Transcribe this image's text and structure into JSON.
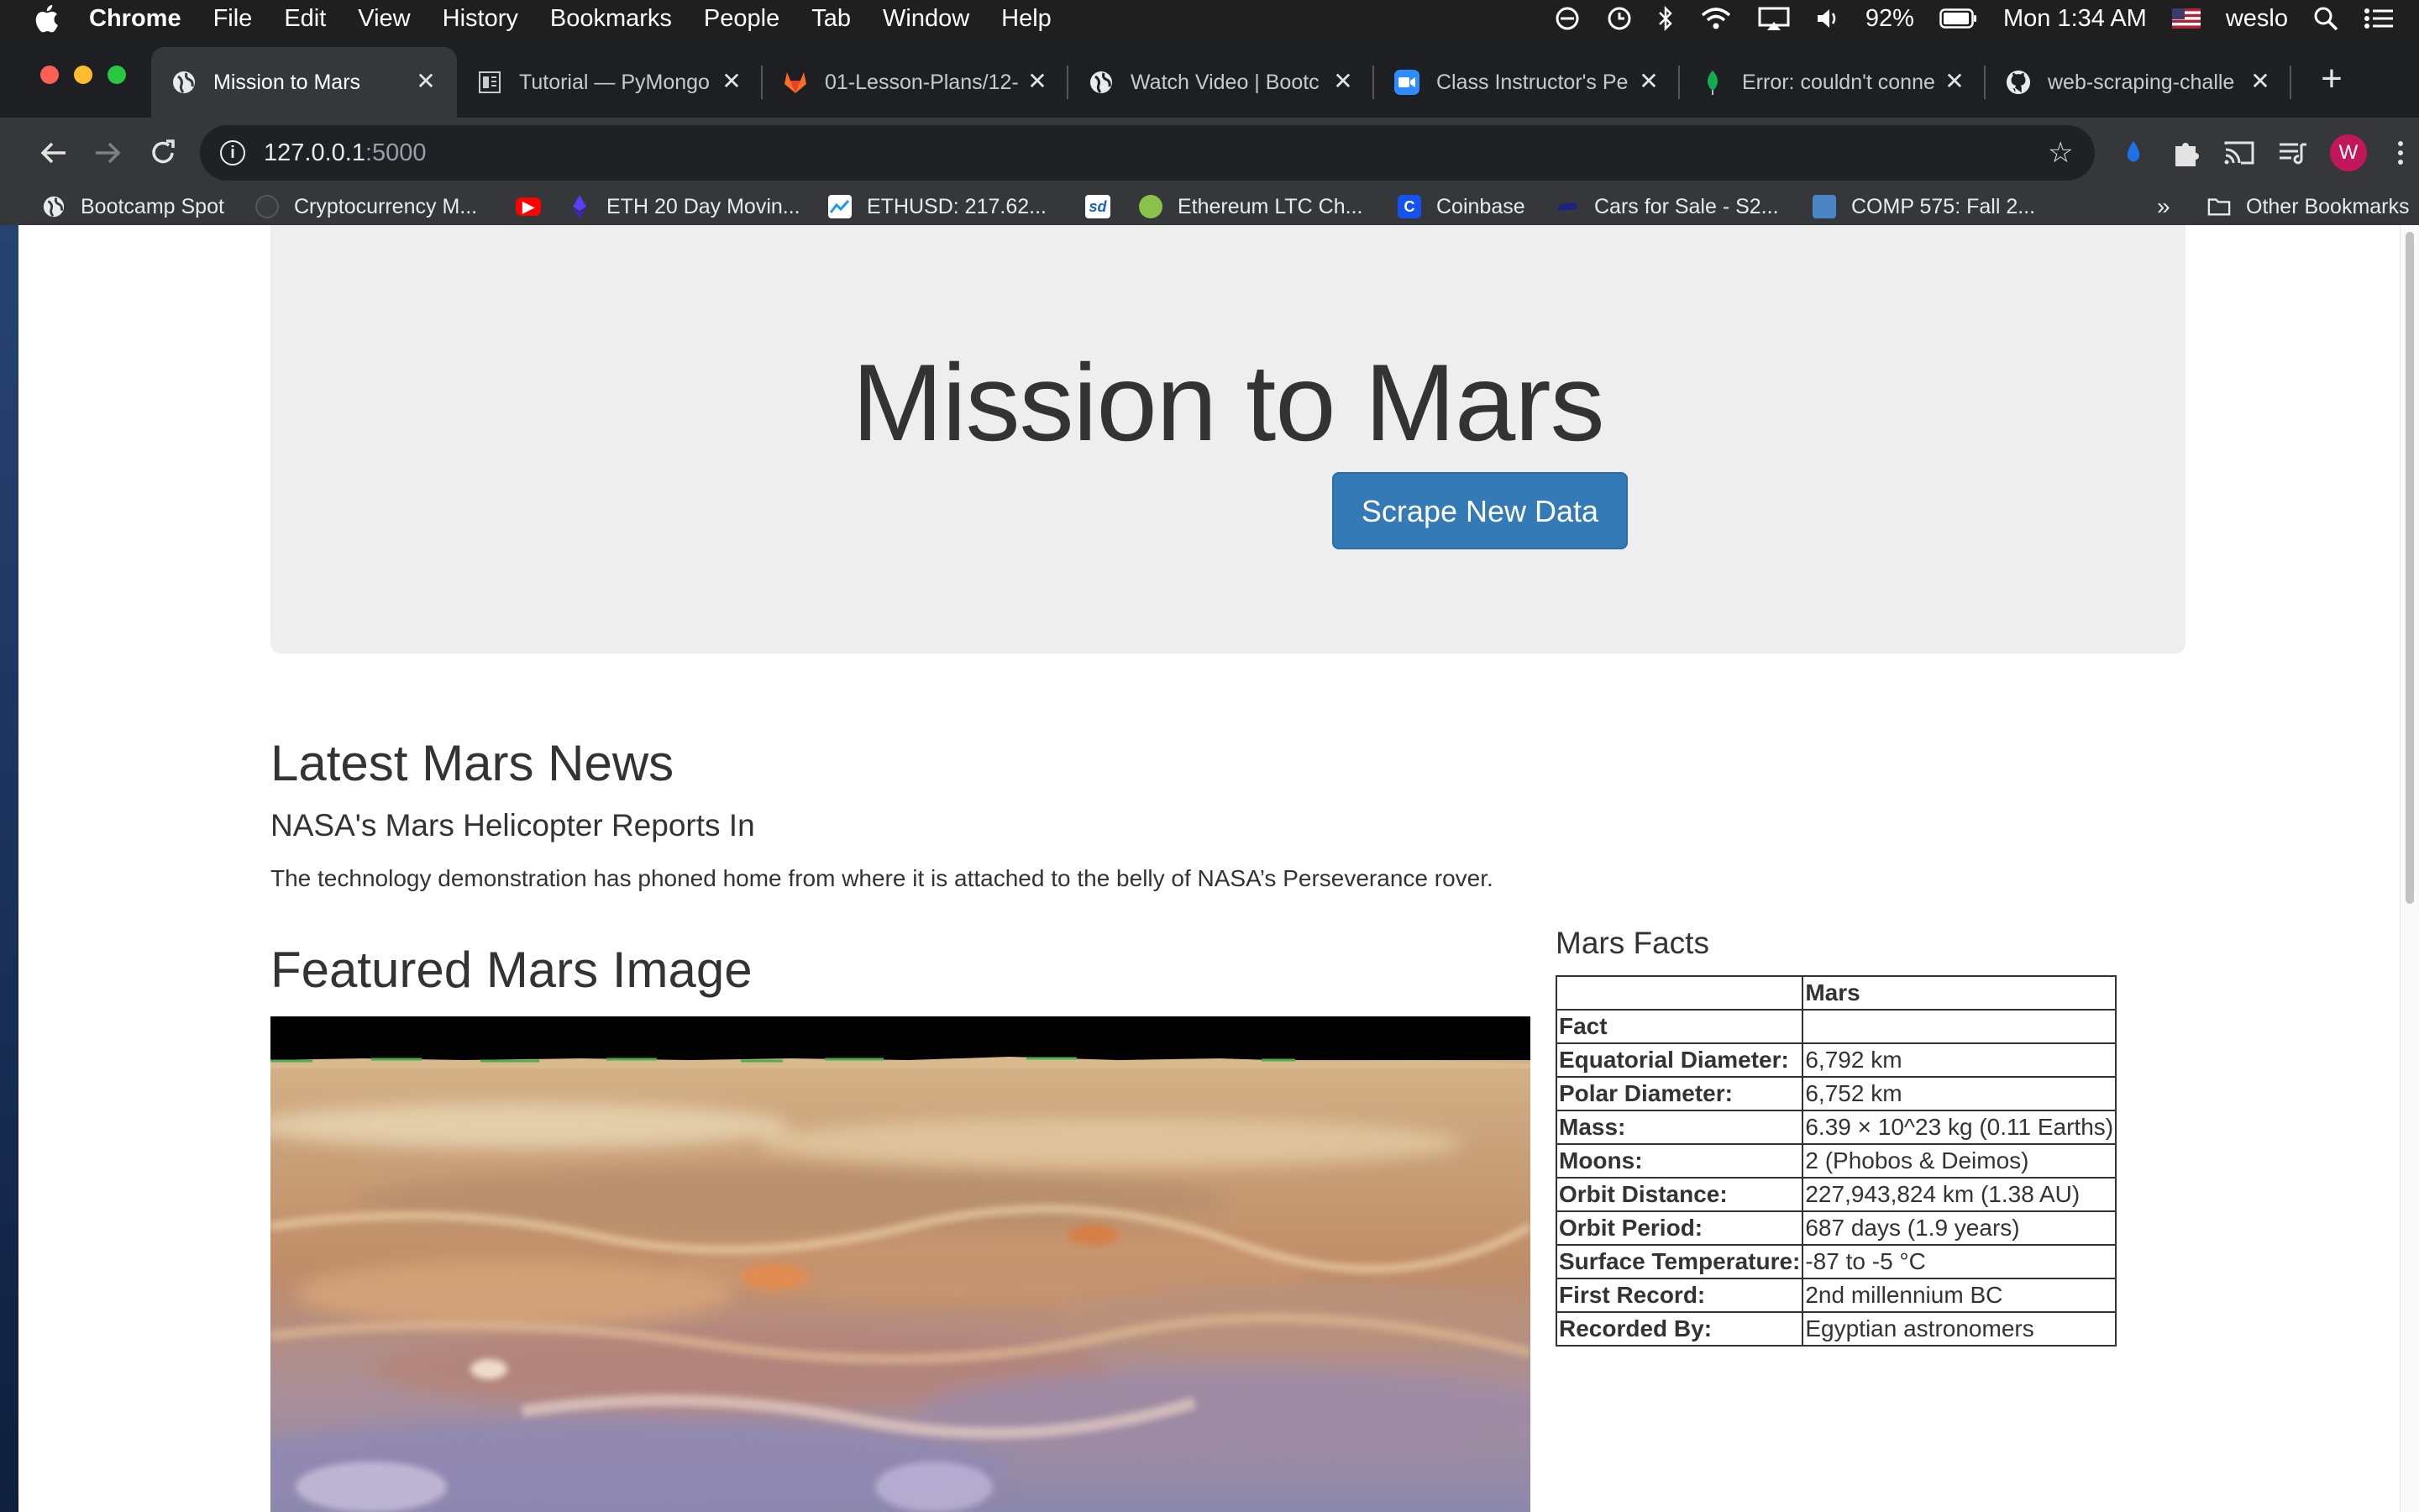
{
  "menubar": {
    "app": "Chrome",
    "items": [
      "File",
      "Edit",
      "View",
      "History",
      "Bookmarks",
      "People",
      "Tab",
      "Window",
      "Help"
    ],
    "battery": "92%",
    "clock": "Mon 1:34 AM",
    "user": "weslo"
  },
  "tabs": [
    {
      "title": "Mission to Mars",
      "icon": "globe-icon",
      "active": true
    },
    {
      "title": "Tutorial — PyMongo",
      "icon": "doc-icon"
    },
    {
      "title": "01-Lesson-Plans/12-",
      "icon": "gitlab-icon"
    },
    {
      "title": "Watch Video | Bootc",
      "icon": "globe-icon"
    },
    {
      "title": "Class Instructor's Pe",
      "icon": "zoom-icon"
    },
    {
      "title": "Error: couldn't conne",
      "icon": "mongodb-leaf-icon"
    },
    {
      "title": "web-scraping-challe",
      "icon": "github-icon"
    }
  ],
  "omnibox": {
    "host": "127.0.0.1",
    "port": ":5000"
  },
  "bookmarks": [
    {
      "label": "Bootcamp Spot",
      "icon": "globe-icon"
    },
    {
      "label": "Cryptocurrency M...",
      "icon": "crypto-icon"
    },
    {
      "label": "",
      "icon": "youtube-icon"
    },
    {
      "label": "ETH 20 Day Movin...",
      "icon": "ethereum-icon"
    },
    {
      "label": "ETHUSD: 217.62...",
      "icon": "chart-icon"
    },
    {
      "label": "",
      "icon": "sd-icon"
    },
    {
      "label": "Ethereum LTC Ch...",
      "icon": "coin-icon"
    },
    {
      "label": "Coinbase",
      "icon": "coinbase-icon"
    },
    {
      "label": "Cars for Sale - S2...",
      "icon": "car-icon"
    },
    {
      "label": "COMP 575: Fall 2...",
      "icon": "course-icon"
    }
  ],
  "bookmarks_overflow": "»",
  "other_bookmarks": "Other Bookmarks",
  "page": {
    "title": "Mission to Mars",
    "scrape_button": "Scrape New Data",
    "news_heading": "Latest Mars News",
    "news_title": "NASA's Mars Helicopter Reports In",
    "news_paragraph": "The technology demonstration has phoned home from where it is attached to the belly of NASA’s Perseverance rover.",
    "featured_heading": "Featured Mars Image",
    "facts_heading": "Mars Facts",
    "facts_table": {
      "header": [
        "",
        "Mars"
      ],
      "index_label": "Fact",
      "rows": [
        [
          "Equatorial Diameter:",
          "6,792 km"
        ],
        [
          "Polar Diameter:",
          "6,752 km"
        ],
        [
          "Mass:",
          "6.39 × 10^23 kg (0.11 Earths)"
        ],
        [
          "Moons:",
          "2 (Phobos & Deimos)"
        ],
        [
          "Orbit Distance:",
          "227,943,824 km (1.38 AU)"
        ],
        [
          "Orbit Period:",
          "687 days (1.9 years)"
        ],
        [
          "Surface Temperature:",
          "-87 to -5 °C"
        ],
        [
          "First Record:",
          "2nd millennium BC"
        ],
        [
          "Recorded By:",
          "Egyptian astronomers"
        ]
      ]
    }
  },
  "colors": {
    "button_bg": "#337ab7",
    "jumbotron_bg": "#eeeeee",
    "avatar": "#c2185b"
  }
}
